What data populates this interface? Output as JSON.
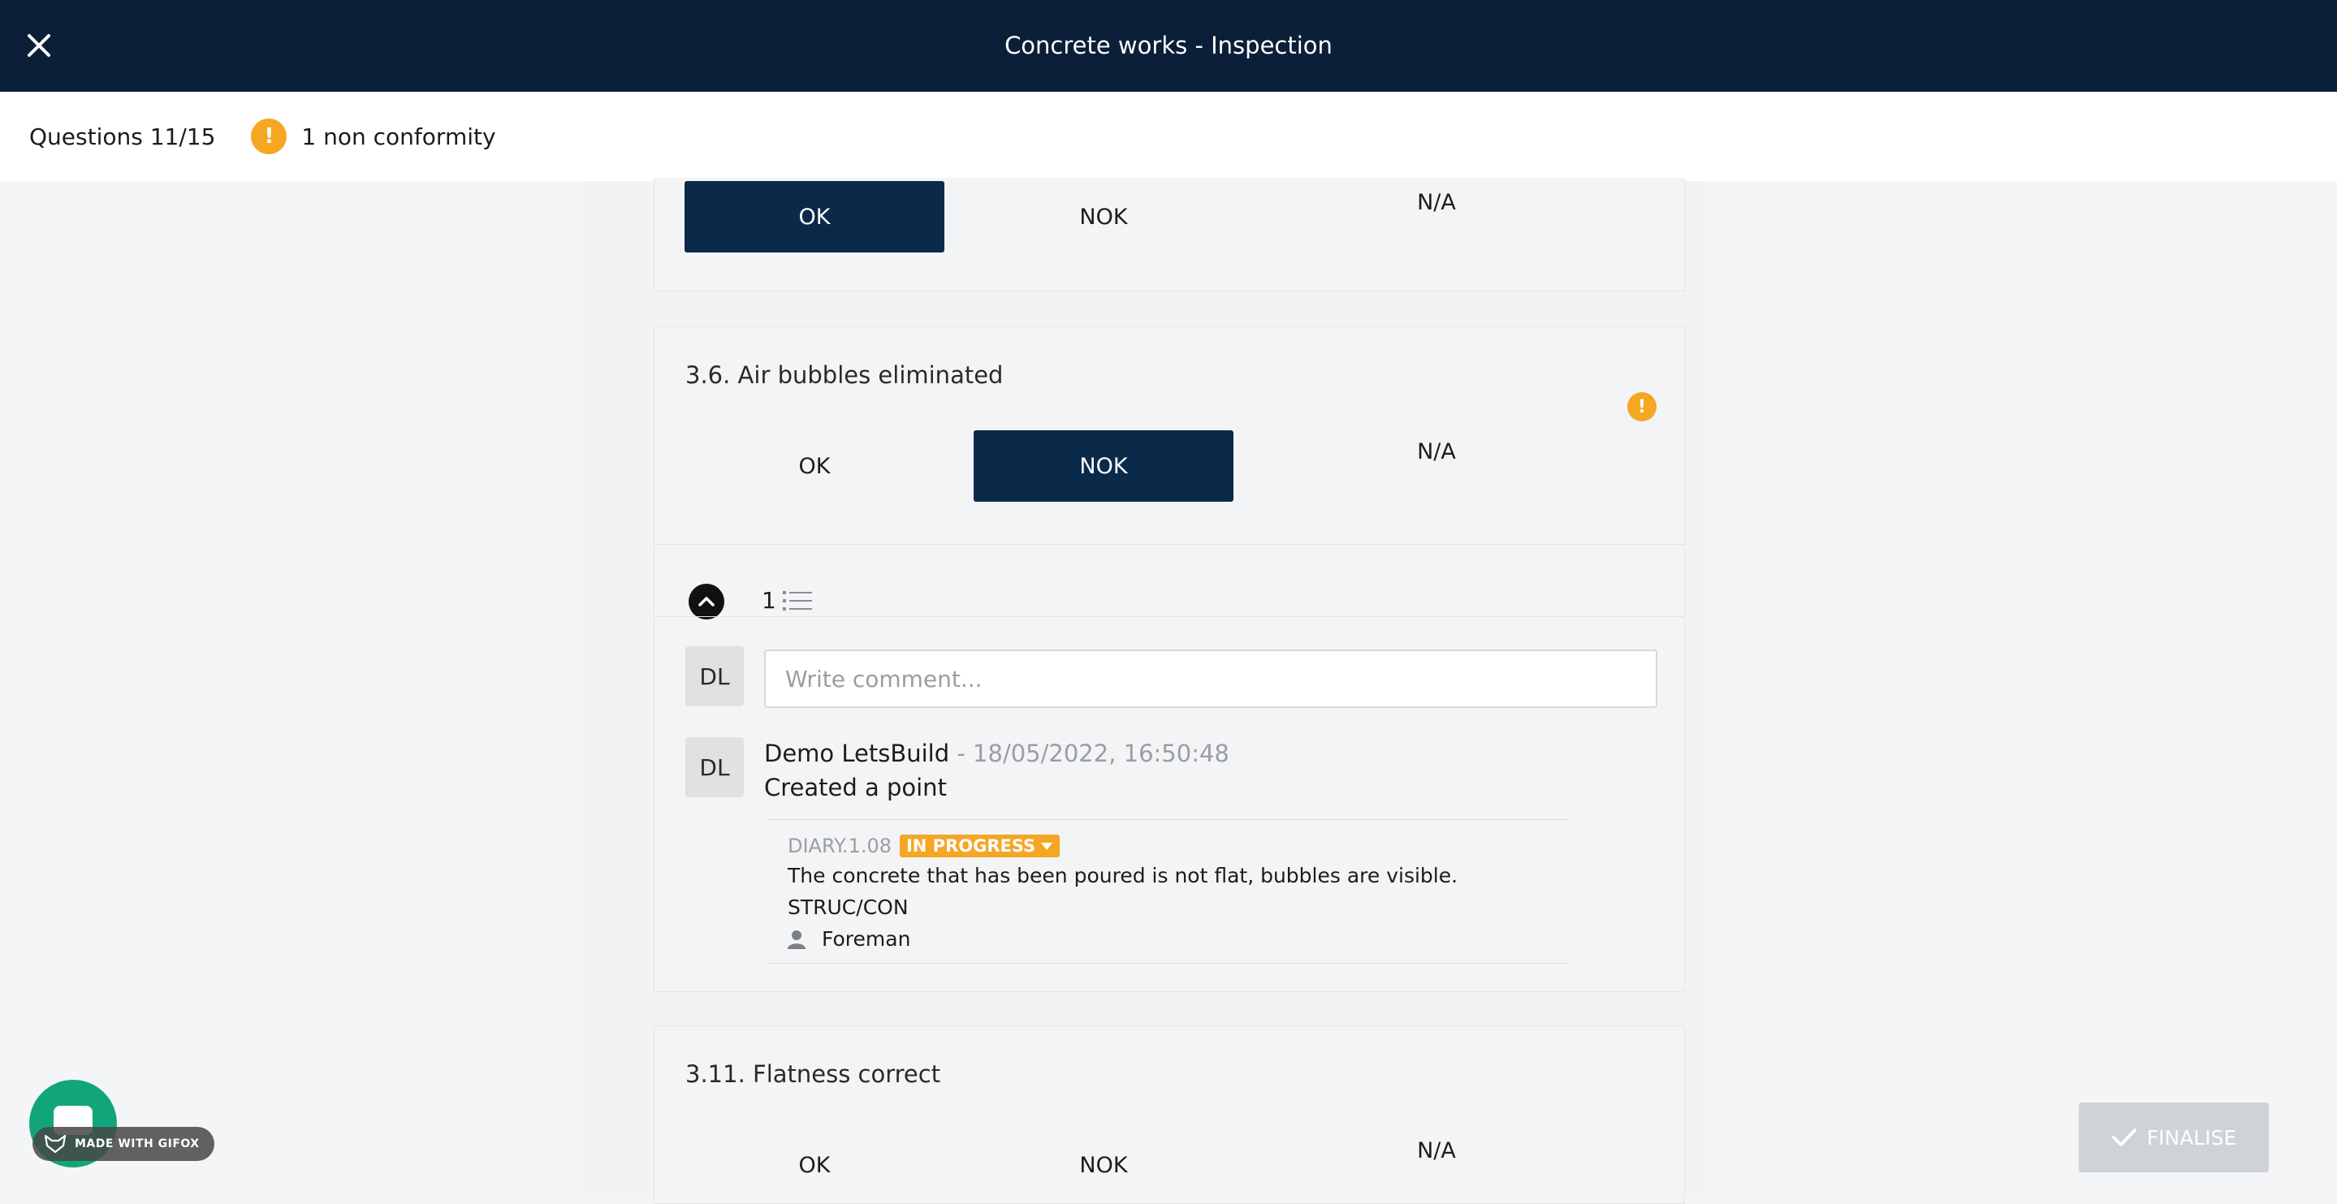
{
  "header": {
    "title": "Concrete works - Inspection"
  },
  "subheader": {
    "questions_label": "Questions 11/15",
    "nonconformity_label": "1 non conformity"
  },
  "choice_labels": {
    "ok": "OK",
    "nok": "NOK",
    "na": "N/A"
  },
  "questions": [
    {
      "selected": "OK"
    },
    {
      "title": "3.6. Air bubbles eliminated",
      "selected": "NOK"
    },
    {
      "title": "3.11. Flatness correct",
      "selected": ""
    }
  ],
  "thread": {
    "count": "1",
    "comment_placeholder": "Write comment...",
    "avatar_initials": "DL",
    "entry": {
      "author": "Demo LetsBuild",
      "timestamp": " - 18/05/2022, 16:50:48",
      "action": "Created a point"
    },
    "point": {
      "code": "DIARY.1.08",
      "status": "IN PROGRESS",
      "description": "The concrete that has been poured is not flat, bubbles are visible.",
      "category": "STRUC/CON",
      "assignee": "Foreman"
    }
  },
  "footer": {
    "finalise_label": "FINALISE",
    "gifox_label": "MADE WITH GIFOX"
  },
  "colors": {
    "topbar": "#0b1f38",
    "selected": "#0b2a4a",
    "warning": "#f5a623",
    "chat": "#12a57a"
  }
}
